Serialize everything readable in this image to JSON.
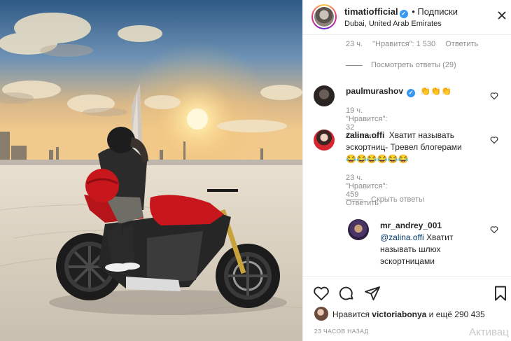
{
  "post": {
    "author": "timatiofficial",
    "follow_label": "• Подписки",
    "location": "Dubai, United Arab Emirates"
  },
  "icons": {
    "verified": "verified-badge-icon",
    "more": "more-options-icon",
    "like": "heart-icon",
    "comment": "comment-bubble-icon",
    "share": "paper-plane-icon",
    "save": "bookmark-icon"
  },
  "comments": {
    "top_row": {
      "time": "23 ч.",
      "likes": "\"Нравится\": 1 530",
      "reply": "Ответить"
    },
    "view_replies": "Посмотреть ответы (29)",
    "c1": {
      "user": "paulmurashov",
      "text": "👏👏👏",
      "time": "19 ч.",
      "likes": "\"Нравится\": 32",
      "reply": "Ответить"
    },
    "c2": {
      "user": "zalina.offi",
      "text_line1": "Хватит называть",
      "text_line2": "эскортниц- Тревел блогерами",
      "text_line3": "😂😂😂😂😂😂",
      "time": "23 ч.",
      "likes": "\"Нравится\": 459",
      "reply": "Ответить"
    },
    "hide_replies": "Скрыть ответы",
    "reply1": {
      "user": "mr_andrey_001",
      "mention": "@zalina.offi",
      "text_line1": "Хватит",
      "text_line2": "называть шлюх",
      "text_line3": "эскортницами"
    }
  },
  "footer": {
    "likes_prefix": "Нравится",
    "likes_user": "victoriabonya",
    "likes_suffix": "и ещё 290 435",
    "timestamp": "23 ЧАСОВ НАЗАД",
    "watermark": "Активац"
  },
  "colors": {
    "link": "#00376b",
    "secondary": "#8e8e8e",
    "verified": "#3897f0",
    "moto_red": "#c8161d"
  }
}
